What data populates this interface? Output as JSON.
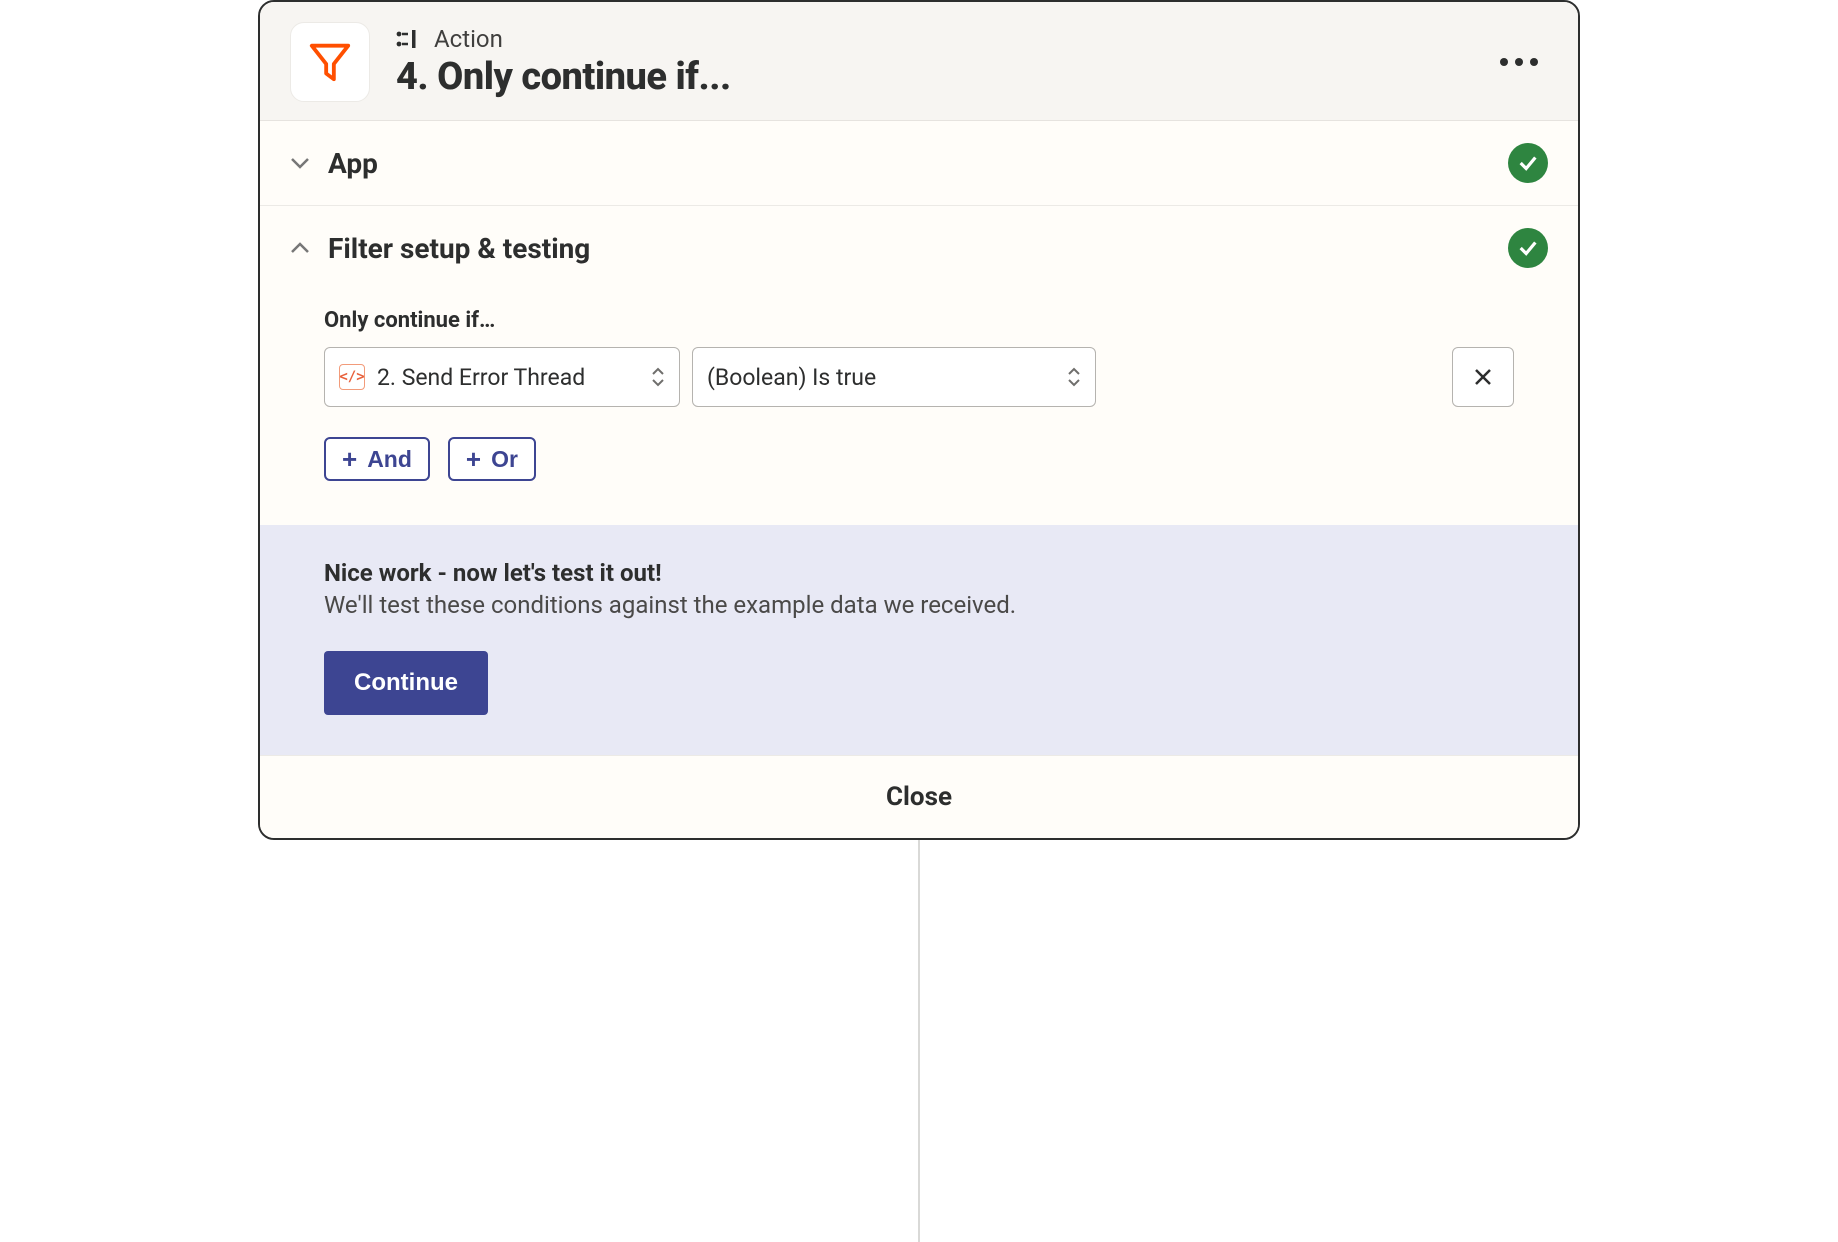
{
  "header": {
    "type_label": "Action",
    "title": "4. Only continue if..."
  },
  "sections": {
    "app": {
      "label": "App",
      "status": "ok"
    },
    "filter": {
      "label": "Filter setup & testing",
      "status": "ok"
    }
  },
  "filter_setup": {
    "field_label": "Only continue if…",
    "condition": {
      "source_label": "2. Send Error Thread",
      "source_icon": "code-icon",
      "operator_label": "(Boolean) Is true"
    },
    "and_label": "And",
    "or_label": "Or"
  },
  "test_panel": {
    "title": "Nice work - now let's test it out!",
    "subtitle": "We'll test these conditions against the example data we received.",
    "continue_label": "Continue"
  },
  "footer": {
    "close_label": "Close"
  }
}
